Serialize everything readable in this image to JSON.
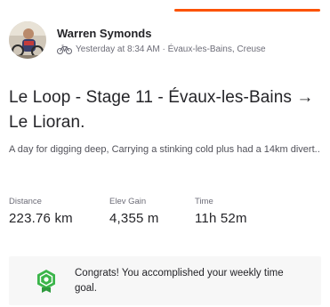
{
  "colors": {
    "accent": "#fc5200",
    "badge": "#3bb54a",
    "text": "#242428",
    "muted": "#6d6d78"
  },
  "activity": {
    "athlete_name": "Warren Symonds",
    "sport_icon": "bike-icon",
    "meta": "Yesterday at 8:34 AM · Évaux-les-Bains, Creuse",
    "title": "Le Loop - Stage 11 - Évaux-les-Bains → Le Lioran.",
    "description": "A day for digging deep, Carrying a stinking cold plus had a 14km divert.."
  },
  "stats": [
    {
      "label": "Distance",
      "value": "223.76 km"
    },
    {
      "label": "Elev Gain",
      "value": "4,355 m"
    },
    {
      "label": "Time",
      "value": "11h 52m"
    }
  ],
  "goal": {
    "icon": "badge-icon",
    "message": "Congrats! You accomplished your weekly time goal."
  }
}
